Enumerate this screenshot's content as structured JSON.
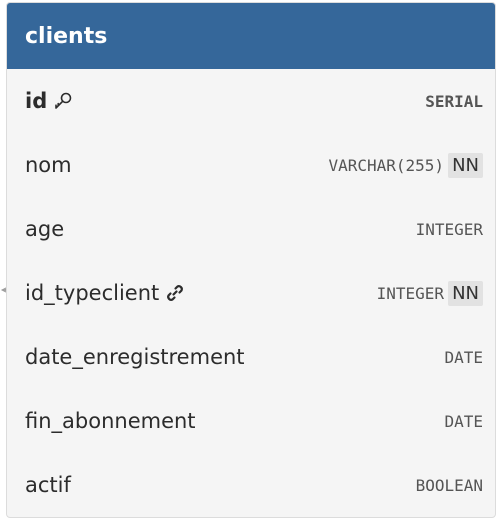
{
  "table": {
    "name": "clients",
    "header_color": "#35679a",
    "columns": [
      {
        "name": "id",
        "type": "SERIAL",
        "not_null": false,
        "primary_key": true,
        "foreign_key": false,
        "icon": "key-icon"
      },
      {
        "name": "nom",
        "type": "VARCHAR(255)",
        "not_null": true,
        "nn_label": "NN",
        "primary_key": false,
        "foreign_key": false
      },
      {
        "name": "age",
        "type": "INTEGER",
        "not_null": false,
        "primary_key": false,
        "foreign_key": false
      },
      {
        "name": "id_typeclient",
        "type": "INTEGER",
        "not_null": true,
        "nn_label": "NN",
        "primary_key": false,
        "foreign_key": true,
        "icon": "link-icon"
      },
      {
        "name": "date_enregistrement",
        "type": "DATE",
        "not_null": false,
        "primary_key": false,
        "foreign_key": false
      },
      {
        "name": "fin_abonnement",
        "type": "DATE",
        "not_null": false,
        "primary_key": false,
        "foreign_key": false
      },
      {
        "name": "actif",
        "type": "BOOLEAN",
        "not_null": false,
        "primary_key": false,
        "foreign_key": false
      }
    ]
  }
}
